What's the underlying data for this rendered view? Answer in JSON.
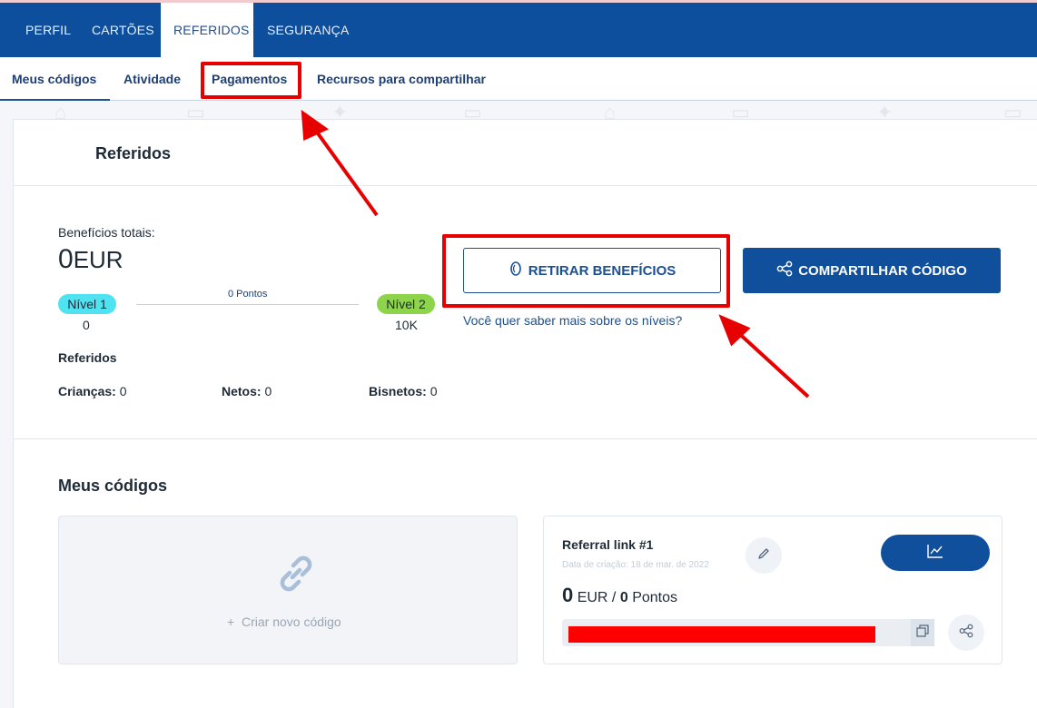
{
  "top_tabs": [
    {
      "label": "PERFIL"
    },
    {
      "label": "CARTÕES"
    },
    {
      "label": "REFERIDOS",
      "active": true
    },
    {
      "label": "SEGURANÇA"
    }
  ],
  "sub_tabs": [
    {
      "label": "Meus códigos",
      "active": true
    },
    {
      "label": "Atividade"
    },
    {
      "label": "Pagamentos"
    },
    {
      "label": "Recursos para compartilhar"
    }
  ],
  "referrals": {
    "title": "Referidos",
    "total_label": "Benefícios totais:",
    "total_amount": "0",
    "total_currency": "EUR",
    "points_label": "0 Pontos",
    "level1": {
      "name": "Nível 1",
      "value": "0"
    },
    "level2": {
      "name": "Nível 2",
      "value": "10K"
    },
    "withdraw_button": "RETIRAR BENEFÍCIOS",
    "share_button": "COMPARTILHAR CÓDIGO",
    "levels_link": "Você quer saber mais sobre os níveis?",
    "stats_title": "Referidos",
    "children_label": "Crianças:",
    "children_value": "0",
    "grandchildren_label": "Netos:",
    "grandchildren_value": "0",
    "greatgrandchildren_label": "Bisnetos:",
    "greatgrandchildren_value": "0"
  },
  "codes": {
    "title": "Meus códigos",
    "create_label": "Criar novo código",
    "create_plus": "+",
    "card": {
      "name": "Referral link #1",
      "created": "Data de criação: 18 de mar. de 2022",
      "amount": "0",
      "currency": "EUR /",
      "points": "0",
      "points_unit": "Pontos"
    }
  },
  "colors": {
    "primary": "#0d4f9c",
    "level1": "#4fe3f2",
    "level2": "#8ed44a",
    "annotation": "#e60000"
  },
  "icons": [
    "coin-icon",
    "share-icon",
    "link-icon",
    "edit-icon",
    "chart-icon",
    "copy-icon"
  ]
}
